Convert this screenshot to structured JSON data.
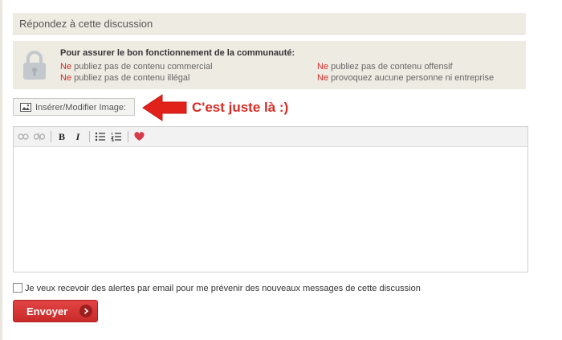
{
  "reply": {
    "header_title": "Répondez à cette discussion"
  },
  "rules": {
    "title": "Pour assurer le bon fonctionnement de la communauté:",
    "items": [
      {
        "ne": "Ne",
        "text": " publiez pas de contenu commercial"
      },
      {
        "ne": "Ne",
        "text": " publiez pas de contenu illégal"
      },
      {
        "ne": "Ne",
        "text": " publiez pas de contenu offensif"
      },
      {
        "ne": "Ne",
        "text": " provoquez aucune personne ni entreprise"
      }
    ]
  },
  "image_button": {
    "label": "Insérer/Modifier Image:",
    "icon": "image-icon"
  },
  "annotation": {
    "text": "C'est juste là :)",
    "color": "#d62b24"
  },
  "toolbar": {
    "icons": [
      "link-icon",
      "unlink-icon",
      "bold-icon",
      "italic-icon",
      "bulleted-list-icon",
      "numbered-list-icon",
      "heart-icon"
    ],
    "bold_glyph": "B",
    "italic_glyph": "I"
  },
  "editor": {
    "value": ""
  },
  "alerts": {
    "checked": false,
    "label": "Je veux recevoir des alertes par email pour me prévenir des nouveaux messages de cette discussion"
  },
  "send_button": {
    "label": "Envoyer"
  },
  "colors": {
    "accent_red": "#cc2a2a",
    "panel_bg": "#eeebe3"
  }
}
